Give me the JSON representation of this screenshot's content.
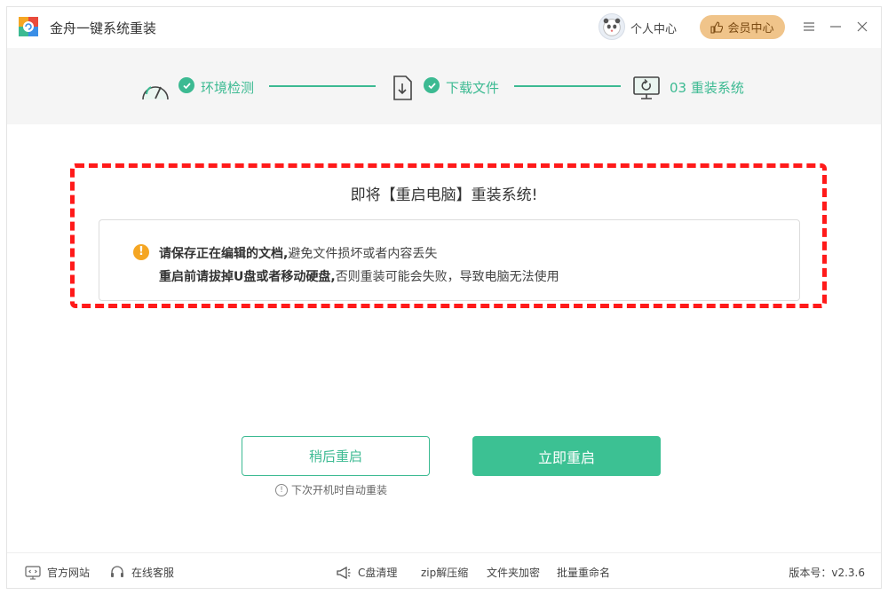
{
  "app": {
    "title": "金舟一键系统重装"
  },
  "header": {
    "user_center": "个人中心",
    "vip_center": "会员中心"
  },
  "steps": [
    {
      "label": "环境检测"
    },
    {
      "label": "下载文件"
    },
    {
      "label": "03 重装系统"
    }
  ],
  "alert": {
    "title": "即将【重启电脑】重装系统!",
    "tip1_bold": "请保存正在编辑的文档,",
    "tip1_rest": "避免文件损坏或者内容丢失",
    "tip2_bold": "重启前请拔掉U盘或者移动硬盘,",
    "tip2_rest": "否则重装可能会失败，导致电脑无法使用"
  },
  "buttons": {
    "later": "稍后重启",
    "now": "立即重启",
    "hint": "下次开机时自动重装"
  },
  "footer": {
    "website": "官方网站",
    "service": "在线客服",
    "c_clean": "C盘清理",
    "zip": "zip解压缩",
    "encrypt": "文件夹加密",
    "rename": "批量重命名",
    "version": "版本号：v2.3.6"
  },
  "colors": {
    "accent": "#3cba92",
    "alert_border": "#ff1a1a",
    "warning": "#f5a623",
    "vip": "#f0c48a"
  }
}
